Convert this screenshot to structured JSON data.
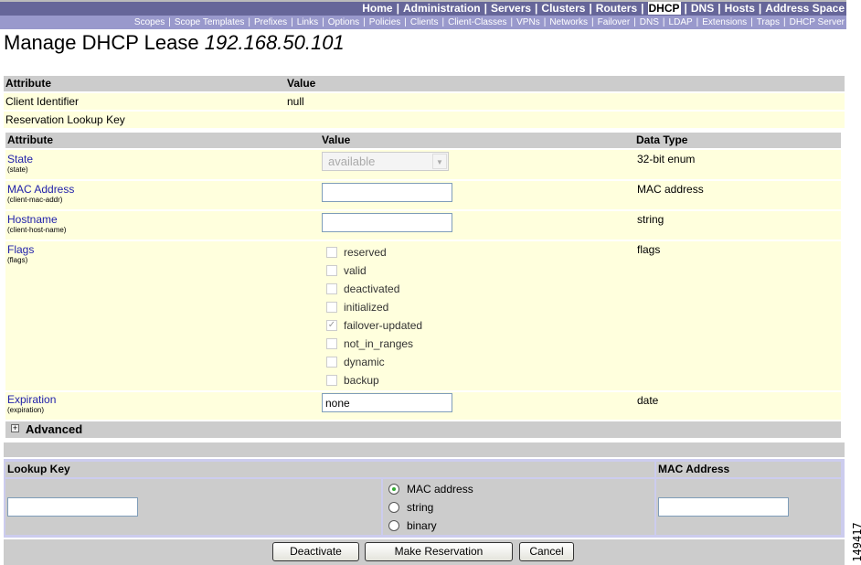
{
  "nav": {
    "primary": [
      "Home",
      "Administration",
      "Servers",
      "Clusters",
      "Routers",
      "DHCP",
      "DNS",
      "Hosts",
      "Address Space"
    ],
    "active": "DHCP",
    "secondary": [
      "Scopes",
      "Scope Templates",
      "Prefixes",
      "Links",
      "Options",
      "Policies",
      "Clients",
      "Client-Classes",
      "VPNs",
      "Networks",
      "Failover",
      "DNS",
      "LDAP",
      "Extensions",
      "Traps",
      "DHCP Server"
    ]
  },
  "title": {
    "text": "Manage DHCP Lease",
    "ip": "192.168.50.101"
  },
  "summary": {
    "headers": [
      "Attribute",
      "Value"
    ],
    "rows": [
      {
        "attr": "Client Identifier",
        "value": "null"
      },
      {
        "attr": "Reservation Lookup Key",
        "value": ""
      }
    ]
  },
  "attrs": {
    "headers": [
      "Attribute",
      "Value",
      "Data Type"
    ],
    "state": {
      "label": "State",
      "key": "(state)",
      "value": "available",
      "type": "32-bit enum"
    },
    "mac": {
      "label": "MAC Address",
      "key": "(client-mac-addr)",
      "value": "",
      "type": "MAC address"
    },
    "hostname": {
      "label": "Hostname",
      "key": "(client-host-name)",
      "value": "",
      "type": "string"
    },
    "flags": {
      "label": "Flags",
      "key": "(flags)",
      "type": "flags",
      "options": [
        {
          "label": "reserved",
          "checked": false
        },
        {
          "label": "valid",
          "checked": false
        },
        {
          "label": "deactivated",
          "checked": false
        },
        {
          "label": "initialized",
          "checked": false
        },
        {
          "label": "failover-updated",
          "checked": true
        },
        {
          "label": "not_in_ranges",
          "checked": false
        },
        {
          "label": "dynamic",
          "checked": false
        },
        {
          "label": "backup",
          "checked": false
        }
      ]
    },
    "expiration": {
      "label": "Expiration",
      "key": "(expiration)",
      "value": "none",
      "type": "date"
    }
  },
  "advanced": {
    "label": "Advanced",
    "icon": "plus-box-icon"
  },
  "lookup": {
    "headers": [
      "Lookup Key",
      "MAC Address"
    ],
    "key_value": "",
    "mac_value": "",
    "types": [
      "MAC address",
      "string",
      "binary"
    ],
    "selected": "MAC address"
  },
  "buttons": {
    "deactivate": "Deactivate",
    "reserve": "Make Reservation",
    "cancel": "Cancel"
  },
  "figure_id": "149417"
}
